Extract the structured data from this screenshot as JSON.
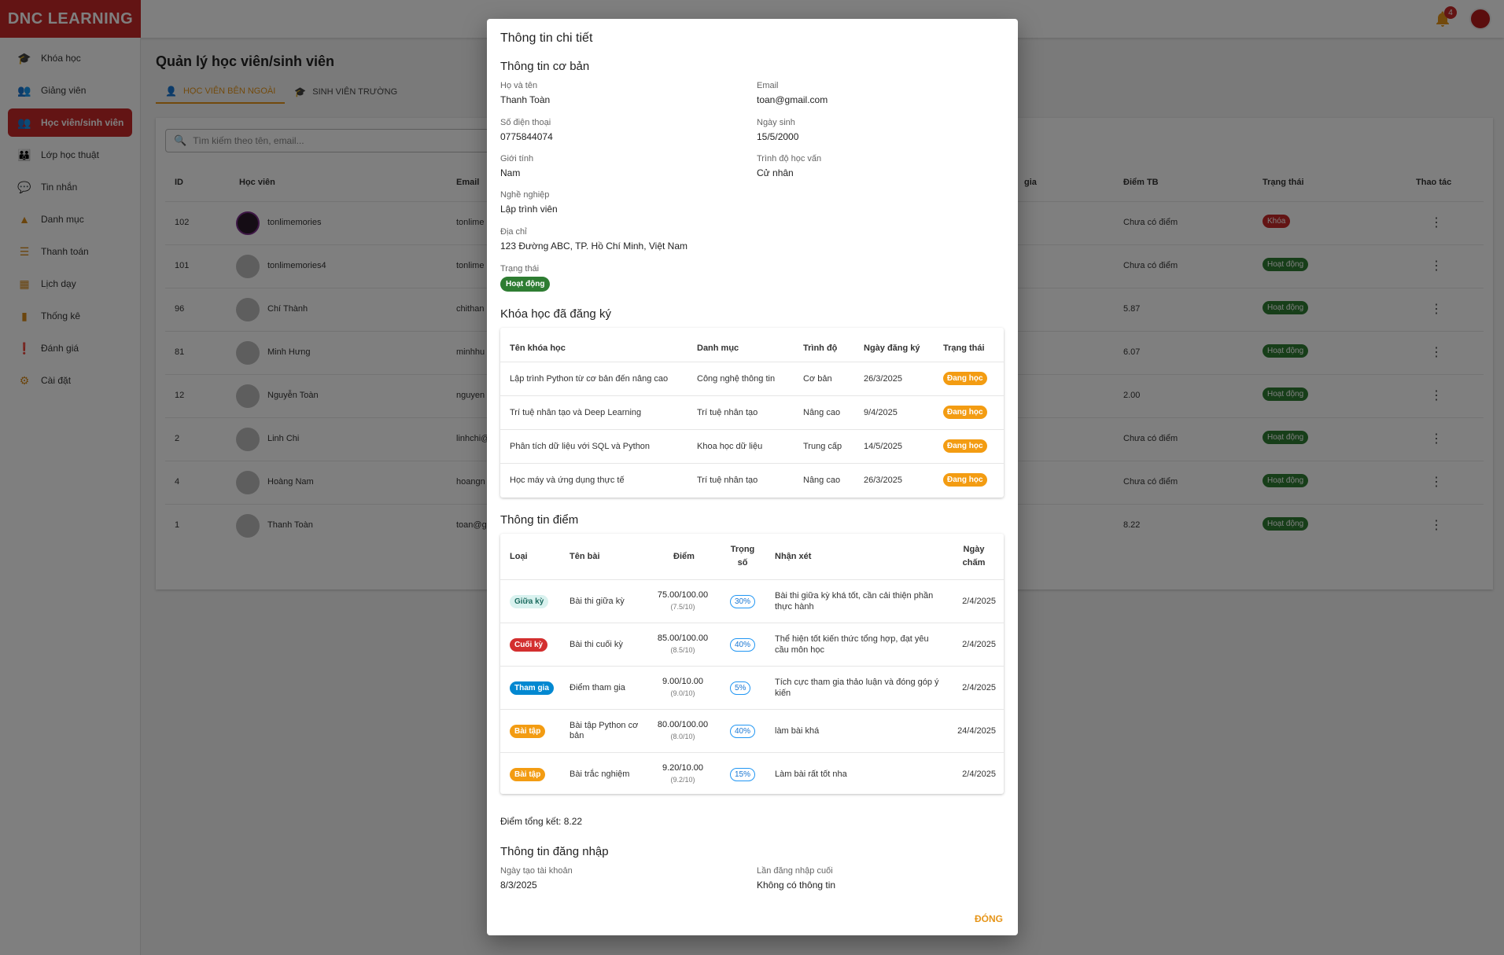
{
  "app": {
    "logo": "DNC LEARNING",
    "notification_count": "4"
  },
  "sidebar": {
    "items": [
      {
        "label": "Khóa học",
        "icon": "school-icon"
      },
      {
        "label": "Giảng viên",
        "icon": "people-icon"
      },
      {
        "label": "Học viên/sinh viên",
        "icon": "people-icon",
        "active": true
      },
      {
        "label": "Lớp học thuật",
        "icon": "group-icon"
      },
      {
        "label": "Tin nhắn",
        "icon": "chat-icon"
      },
      {
        "label": "Danh mục",
        "icon": "category-icon"
      },
      {
        "label": "Thanh toán",
        "icon": "list-icon"
      },
      {
        "label": "Lịch dạy",
        "icon": "calendar-icon"
      },
      {
        "label": "Thống kê",
        "icon": "bar-chart-icon"
      },
      {
        "label": "Đánh giá",
        "icon": "feedback-icon"
      },
      {
        "label": "Cài đặt",
        "icon": "gear-icon"
      }
    ]
  },
  "page": {
    "title": "Quản lý học viên/sinh viên",
    "tabs": [
      {
        "label": "HỌC VIÊN BÊN NGOÀI",
        "active": true
      },
      {
        "label": "SINH VIÊN TRƯỜNG",
        "active": false
      }
    ],
    "search_placeholder": "Tìm kiếm theo tên, email..."
  },
  "table": {
    "headers": {
      "id": "ID",
      "student": "Học viên",
      "email": "Email",
      "partial": "gia",
      "avg": "Điểm TB",
      "status": "Trạng thái",
      "actions": "Thao tác"
    },
    "rows": [
      {
        "id": "102",
        "name": "tonlimemories",
        "email": "tonlime",
        "avg": "Chưa có điểm",
        "status": "Khóa",
        "photo": true
      },
      {
        "id": "101",
        "name": "tonlimemories4",
        "email": "tonlime",
        "avg": "Chưa có điểm",
        "status": "Hoạt động"
      },
      {
        "id": "96",
        "name": "Chí Thành",
        "email": "chithan",
        "avg": "5.87",
        "status": "Hoạt động"
      },
      {
        "id": "81",
        "name": "Minh Hưng",
        "email": "minhhu",
        "avg": "6.07",
        "status": "Hoạt động"
      },
      {
        "id": "12",
        "name": "Nguyễn Toàn",
        "email": "nguyen",
        "avg": "2.00",
        "status": "Hoạt động"
      },
      {
        "id": "2",
        "name": "Linh Chi",
        "email": "linhchi@",
        "avg": "Chưa có điểm",
        "status": "Hoạt động"
      },
      {
        "id": "4",
        "name": "Hoàng Nam",
        "email": "hoangn",
        "avg": "Chưa có điểm",
        "status": "Hoạt động"
      },
      {
        "id": "1",
        "name": "Thanh Toàn",
        "email": "toan@g",
        "avg": "8.22",
        "status": "Hoạt động"
      }
    ]
  },
  "dialog": {
    "title": "Thông tin chi tiết",
    "basic_title": "Thông tin cơ bản",
    "fields": {
      "name_label": "Họ và tên",
      "name": "Thanh Toàn",
      "email_label": "Email",
      "email": "toan@gmail.com",
      "phone_label": "Số điện thoại",
      "phone": "0775844074",
      "dob_label": "Ngày sinh",
      "dob": "15/5/2000",
      "gender_label": "Giới tính",
      "gender": "Nam",
      "edu_label": "Trình độ học vấn",
      "edu": "Cử nhân",
      "job_label": "Nghề nghiệp",
      "job": "Lập trình viên",
      "address_label": "Địa chỉ",
      "address": "123 Đường ABC, TP. Hồ Chí Minh, Việt Nam",
      "status_label": "Trạng thái",
      "status": "Hoạt động"
    },
    "courses_title": "Khóa học đã đăng ký",
    "courses_headers": {
      "name": "Tên khóa học",
      "category": "Danh mục",
      "level": "Trình độ",
      "date": "Ngày đăng ký",
      "status": "Trạng thái"
    },
    "courses": [
      {
        "name": "Lập trình Python từ cơ bản đến nâng cao",
        "category": "Công nghệ thông tin",
        "level": "Cơ bản",
        "date": "26/3/2025",
        "status": "Đang học"
      },
      {
        "name": "Trí tuệ nhân tạo và Deep Learning",
        "category": "Trí tuệ nhân tạo",
        "level": "Nâng cao",
        "date": "9/4/2025",
        "status": "Đang học"
      },
      {
        "name": "Phân tích dữ liệu với SQL và Python",
        "category": "Khoa học dữ liệu",
        "level": "Trung cấp",
        "date": "14/5/2025",
        "status": "Đang học"
      },
      {
        "name": "Học máy và ứng dụng thực tế",
        "category": "Trí tuệ nhân tạo",
        "level": "Nâng cao",
        "date": "26/3/2025",
        "status": "Đang học"
      }
    ],
    "scores_title": "Thông tin điểm",
    "scores_headers": {
      "type": "Loại",
      "name": "Tên bài",
      "score": "Điểm",
      "weight_1": "Trọng",
      "weight_2": "số",
      "comment": "Nhận xét",
      "date_1": "Ngày",
      "date_2": "chấm"
    },
    "scores": [
      {
        "type": "Giữa kỳ",
        "type_bg": "#d9f2ef",
        "type_fg": "#1b6b5f",
        "name_1": "Bài thi giữa kỳ",
        "name_2": "",
        "score": "75.00/100.00",
        "sub": "(7.5/10)",
        "weight": "30%",
        "comment_1": "Bài thi giữa kỳ khá tốt, cần cải thiện phần",
        "comment_2": "thực hành",
        "date": "2/4/2025"
      },
      {
        "type": "Cuối kỳ",
        "type_bg": "#d32f2f",
        "type_fg": "#ffffff",
        "name_1": "Bài thi cuối kỳ",
        "name_2": "",
        "score": "85.00/100.00",
        "sub": "(8.5/10)",
        "weight": "40%",
        "comment_1": "Thể hiện tốt kiến thức tổng hợp, đạt yêu",
        "comment_2": "cầu môn học",
        "date": "2/4/2025"
      },
      {
        "type": "Tham gia",
        "type_bg": "#0288d1",
        "type_fg": "#ffffff",
        "name_1": "Điểm tham gia",
        "name_2": "",
        "score": "9.00/10.00",
        "sub": "(9.0/10)",
        "weight": "5%",
        "comment_1": "Tích cực tham gia thảo luận và đóng góp ý",
        "comment_2": "kiến",
        "date": "2/4/2025"
      },
      {
        "type": "Bài tập",
        "type_bg": "#f39c12",
        "type_fg": "#ffffff",
        "name_1": "Bài tập Python cơ",
        "name_2": "bản",
        "score": "80.00/100.00",
        "sub": "(8.0/10)",
        "weight": "40%",
        "comment_1": "làm bài khá",
        "comment_2": "",
        "date": "24/4/2025"
      },
      {
        "type": "Bài tập",
        "type_bg": "#f39c12",
        "type_fg": "#ffffff",
        "name_1": "Bài trắc nghiệm",
        "name_2": "",
        "score": "9.20/10.00",
        "sub": "(9.2/10)",
        "weight": "15%",
        "comment_1": "Làm bài rất tốt nha",
        "comment_2": "",
        "date": "2/4/2025"
      }
    ],
    "final_score": "Điểm tổng kết: 8.22",
    "login_title": "Thông tin đăng nhập",
    "created_label": "Ngày tạo tài khoản",
    "created": "8/3/2025",
    "last_login_label": "Lần đăng nhập cuối",
    "last_login": "Không có thông tin",
    "close_label": "ĐÓNG"
  },
  "colors": {
    "brand": "#c62828",
    "accent": "#e69519",
    "active_status": "#2e7d32"
  }
}
